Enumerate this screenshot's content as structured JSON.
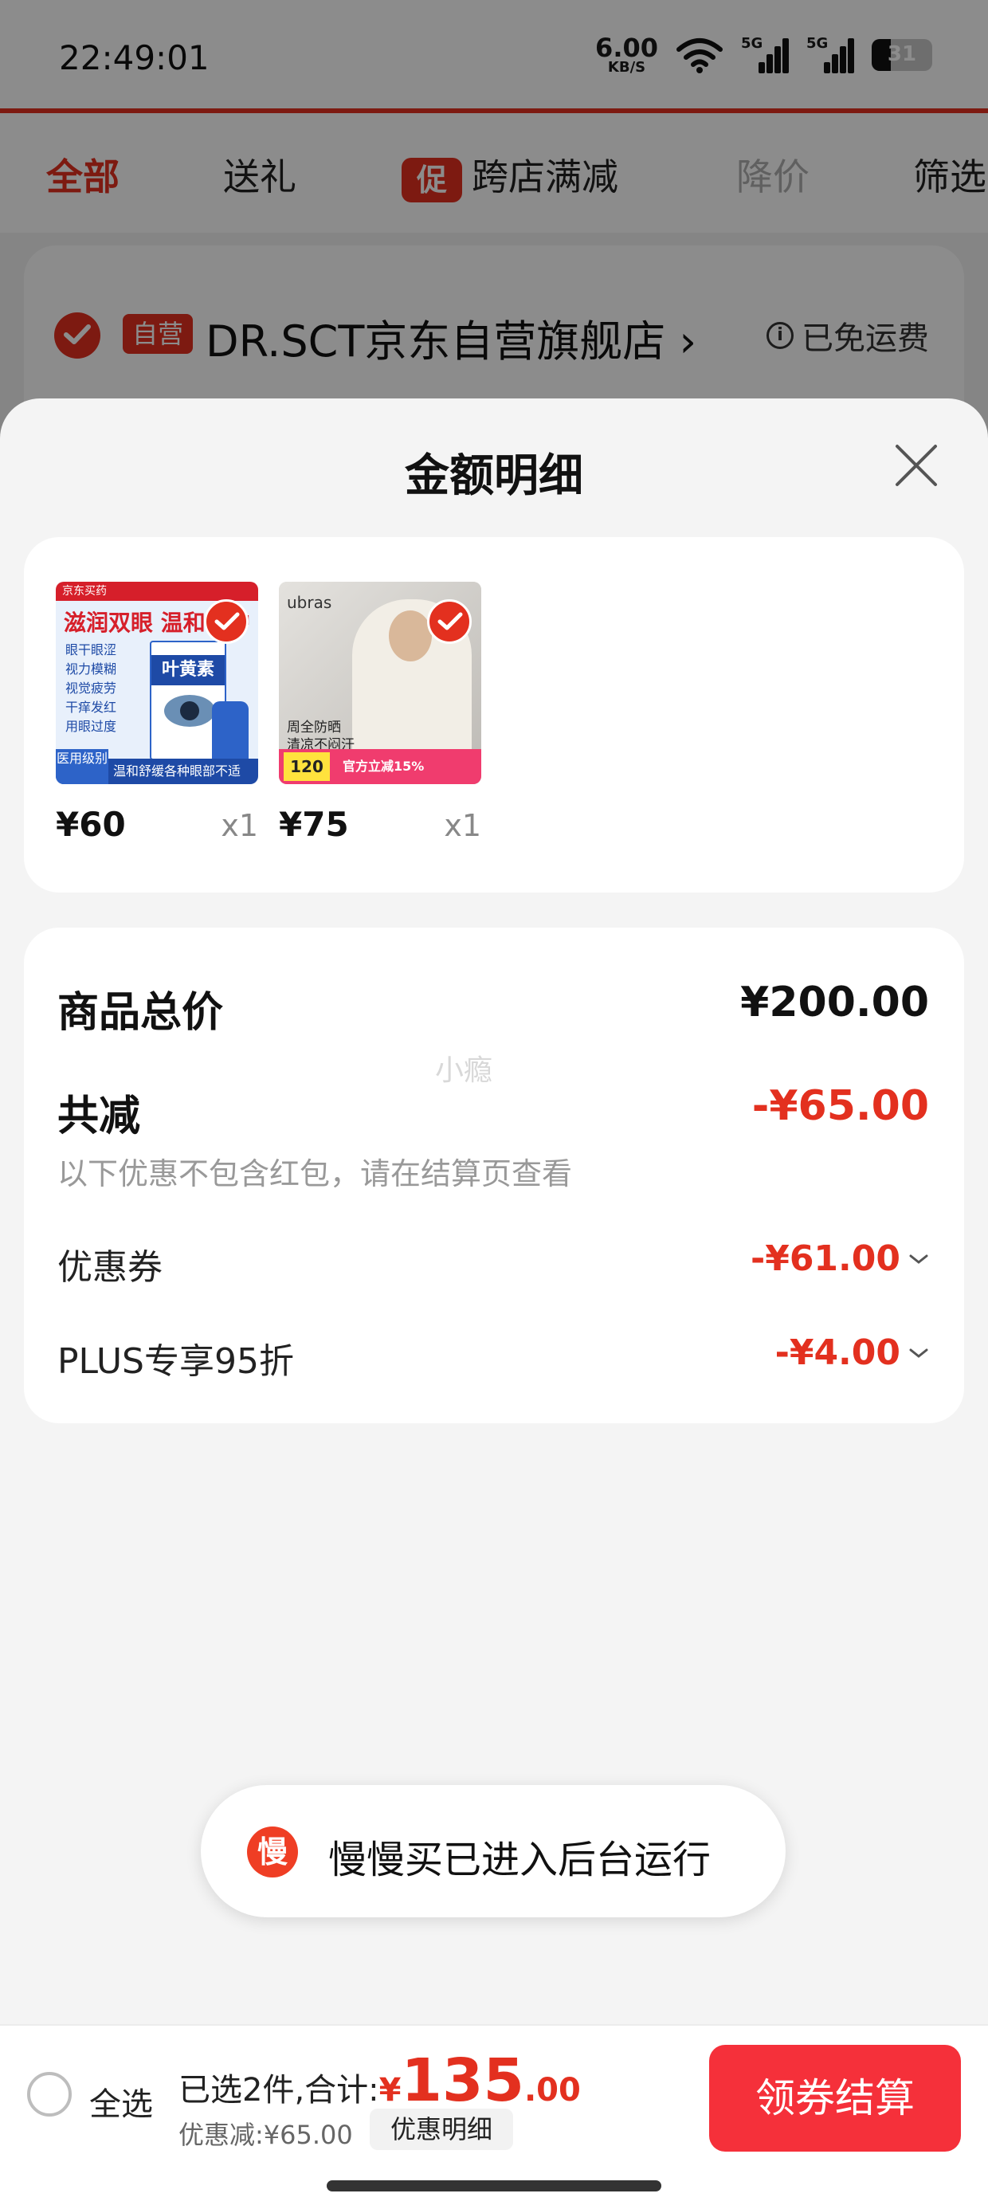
{
  "status_bar": {
    "time": "22:49:01",
    "net_speed": "6.00",
    "net_unit": "KB/S",
    "sig1_label": "5G",
    "sig2_label": "5G",
    "battery": "31"
  },
  "tabs": [
    {
      "label": "全部",
      "state": "active"
    },
    {
      "label": "送礼",
      "state": "normal"
    },
    {
      "label": "跨店满减",
      "badge": "促",
      "state": "normal"
    },
    {
      "label": "降价",
      "state": "disabled"
    },
    {
      "label": "筛选",
      "state": "normal"
    }
  ],
  "store": {
    "tag": "自营",
    "name": "DR.SCT京东自营旗舰店",
    "chevron": "›",
    "shipping": "已免运费",
    "info_glyph": "i"
  },
  "sheet": {
    "title": "金额明细",
    "products": [
      {
        "price": "¥60",
        "qty": "x1",
        "img_top": "京东买药",
        "img_headline": "滋润双眼 温和呵护",
        "img_list": [
          "眼干眼涩",
          "视力模糊",
          "视觉疲劳",
          "干痒发红",
          "用眼过度"
        ],
        "img_box_name": "叶黄素",
        "img_foot": "温和舒缓各种眼部不适",
        "img_badge": "医用级别"
      },
      {
        "price": "¥75",
        "qty": "x1",
        "img_brand": "ubras",
        "img_text": [
          "周全防晒",
          "清凉不闷汗"
        ],
        "img_price": "120",
        "img_off": "官方立减15%"
      }
    ],
    "watermark": "小瘾",
    "rows": {
      "total_label": "商品总价",
      "total_value": "¥200.00",
      "reduce_label": "共减",
      "reduce_value": "-¥65.00",
      "note": "以下优惠不包含红包，请在结算页查看",
      "coupon_label": "优惠券",
      "coupon_value": "-¥61.00",
      "plus_label": "PLUS专享95折",
      "plus_value": "-¥4.00"
    }
  },
  "toast": {
    "icon_char": "慢",
    "text": "慢慢买已进入后台运行"
  },
  "bottom_bar": {
    "select_all": "全选",
    "summary_prefix": "已选2件,合计:",
    "currency": "¥",
    "amount_int": "135",
    "amount_dec": ".00",
    "discount": "优惠减:¥65.00",
    "detail_button": "优惠明细",
    "checkout": "领券结算"
  },
  "colors": {
    "accent": "#e3301f",
    "checkout_bg": "#f5303a"
  }
}
